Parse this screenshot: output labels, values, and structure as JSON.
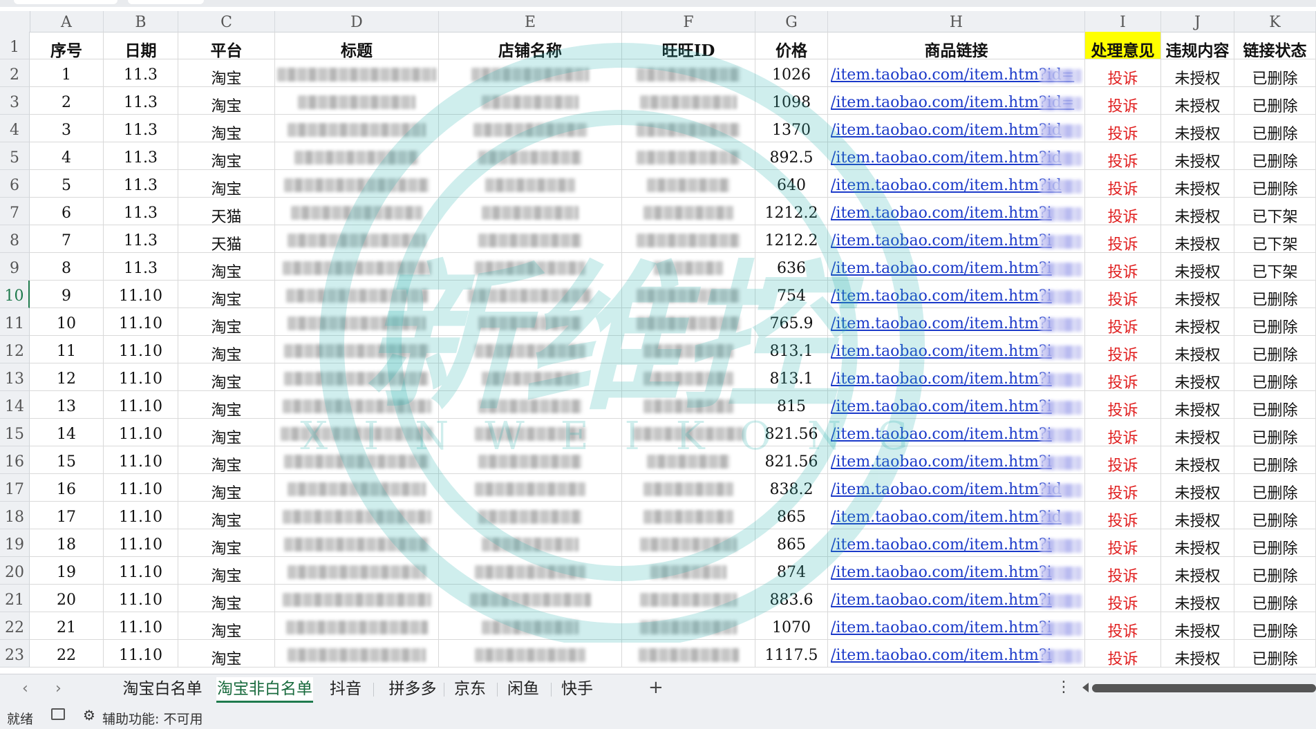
{
  "columns": [
    "A",
    "B",
    "C",
    "D",
    "E",
    "F",
    "G",
    "H",
    "I",
    "J",
    "K"
  ],
  "header_row_number": "1",
  "headers": [
    "序号",
    "日期",
    "平台",
    "标题",
    "店铺名称",
    "旺旺ID",
    "价格",
    "商品链接",
    "处理意见",
    "违规内容",
    "链接状态"
  ],
  "rows": [
    {
      "row": "2",
      "no": "1",
      "date": "11.3",
      "platform": "淘宝",
      "price": "1026",
      "link": "/item.taobao.com/item.htm?id=",
      "action": "投诉",
      "violation": "未授权",
      "status": "已删除"
    },
    {
      "row": "3",
      "no": "2",
      "date": "11.3",
      "platform": "淘宝",
      "price": "1098",
      "link": "/item.taobao.com/item.htm?id=",
      "action": "投诉",
      "violation": "未授权",
      "status": "已删除"
    },
    {
      "row": "4",
      "no": "3",
      "date": "11.3",
      "platform": "淘宝",
      "price": "1370",
      "link": "/item.taobao.com/item.htm?id",
      "action": "投诉",
      "violation": "未授权",
      "status": "已删除"
    },
    {
      "row": "5",
      "no": "4",
      "date": "11.3",
      "platform": "淘宝",
      "price": "892.5",
      "link": "/item.taobao.com/item.htm?id",
      "action": "投诉",
      "violation": "未授权",
      "status": "已删除"
    },
    {
      "row": "6",
      "no": "5",
      "date": "11.3",
      "platform": "淘宝",
      "price": "640",
      "link": "/item.taobao.com/item.htm?id",
      "action": "投诉",
      "violation": "未授权",
      "status": "已删除"
    },
    {
      "row": "7",
      "no": "6",
      "date": "11.3",
      "platform": "天猫",
      "price": "1212.2",
      "link": "/item.taobao.com/item.htm?i",
      "action": "投诉",
      "violation": "未授权",
      "status": "已下架"
    },
    {
      "row": "8",
      "no": "7",
      "date": "11.3",
      "platform": "天猫",
      "price": "1212.2",
      "link": "/item.taobao.com/item.htm?i",
      "action": "投诉",
      "violation": "未授权",
      "status": "已下架"
    },
    {
      "row": "9",
      "no": "8",
      "date": "11.3",
      "platform": "淘宝",
      "price": "636",
      "link": "/item.taobao.com/item.htm?i",
      "action": "投诉",
      "violation": "未授权",
      "status": "已下架"
    },
    {
      "row": "10",
      "no": "9",
      "date": "11.10",
      "platform": "淘宝",
      "price": "754",
      "link": "/item.taobao.com/item.htm?i",
      "action": "投诉",
      "violation": "未授权",
      "status": "已删除"
    },
    {
      "row": "11",
      "no": "10",
      "date": "11.10",
      "platform": "淘宝",
      "price": "765.9",
      "link": "/item.taobao.com/item.htm?i",
      "action": "投诉",
      "violation": "未授权",
      "status": "已删除"
    },
    {
      "row": "12",
      "no": "11",
      "date": "11.10",
      "platform": "淘宝",
      "price": "813.1",
      "link": "/item.taobao.com/item.htm?i",
      "action": "投诉",
      "violation": "未授权",
      "status": "已删除"
    },
    {
      "row": "13",
      "no": "12",
      "date": "11.10",
      "platform": "淘宝",
      "price": "813.1",
      "link": "/item.taobao.com/item.htm?i",
      "action": "投诉",
      "violation": "未授权",
      "status": "已删除"
    },
    {
      "row": "14",
      "no": "13",
      "date": "11.10",
      "platform": "淘宝",
      "price": "815",
      "link": "/item.taobao.com/item.htm?i",
      "action": "投诉",
      "violation": "未授权",
      "status": "已删除"
    },
    {
      "row": "15",
      "no": "14",
      "date": "11.10",
      "platform": "淘宝",
      "price": "821.56",
      "link": "/item.taobao.com/item.htm?i",
      "action": "投诉",
      "violation": "未授权",
      "status": "已删除"
    },
    {
      "row": "16",
      "no": "15",
      "date": "11.10",
      "platform": "淘宝",
      "price": "821.56",
      "link": "/item.taobao.com/item.htm?i",
      "action": "投诉",
      "violation": "未授权",
      "status": "已删除"
    },
    {
      "row": "17",
      "no": "16",
      "date": "11.10",
      "platform": "淘宝",
      "price": "838.2",
      "link": "/item.taobao.com/item.htm?id",
      "action": "投诉",
      "violation": "未授权",
      "status": "已删除"
    },
    {
      "row": "18",
      "no": "17",
      "date": "11.10",
      "platform": "淘宝",
      "price": "865",
      "link": "/item.taobao.com/item.htm?id",
      "action": "投诉",
      "violation": "未授权",
      "status": "已删除"
    },
    {
      "row": "19",
      "no": "18",
      "date": "11.10",
      "platform": "淘宝",
      "price": "865",
      "link": "/item.taobao.com/item.htm?i",
      "action": "投诉",
      "violation": "未授权",
      "status": "已删除"
    },
    {
      "row": "20",
      "no": "19",
      "date": "11.10",
      "platform": "淘宝",
      "price": "874",
      "link": "/item.taobao.com/item.htm?i",
      "action": "投诉",
      "violation": "未授权",
      "status": "已删除"
    },
    {
      "row": "21",
      "no": "20",
      "date": "11.10",
      "platform": "淘宝",
      "price": "883.6",
      "link": "/item.taobao.com/item.htm?i",
      "action": "投诉",
      "violation": "未授权",
      "status": "已删除"
    },
    {
      "row": "22",
      "no": "21",
      "date": "11.10",
      "platform": "淘宝",
      "price": "1070",
      "link": "/item.taobao.com/item.htm?i",
      "action": "投诉",
      "violation": "未授权",
      "status": "已删除"
    },
    {
      "row": "23",
      "no": "22",
      "date": "11.10",
      "platform": "淘宝",
      "price": "1117.5",
      "link": "/item.taobao.com/item.htm?i",
      "action": "投诉",
      "violation": "未授权",
      "status": "已删除"
    }
  ],
  "sheet_tabs": [
    "淘宝白名单",
    "淘宝非白名单",
    "抖音",
    "拼多多",
    "京东",
    "闲鱼",
    "快手"
  ],
  "active_sheet": "淘宝非白名单",
  "add_sheet_label": "+",
  "more_icon": "⋮",
  "status": {
    "ready": "就绪",
    "accessibility": "辅助功能: 不可用"
  },
  "watermark": {
    "text": "新维控",
    "subtext": "XINWEIKONG",
    "color": "#2bb3b0"
  },
  "colors": {
    "highlight": "#ffff00",
    "action_red": "#e02020",
    "link_blue": "#1a39c9",
    "active_tab": "#1f7a4d"
  }
}
